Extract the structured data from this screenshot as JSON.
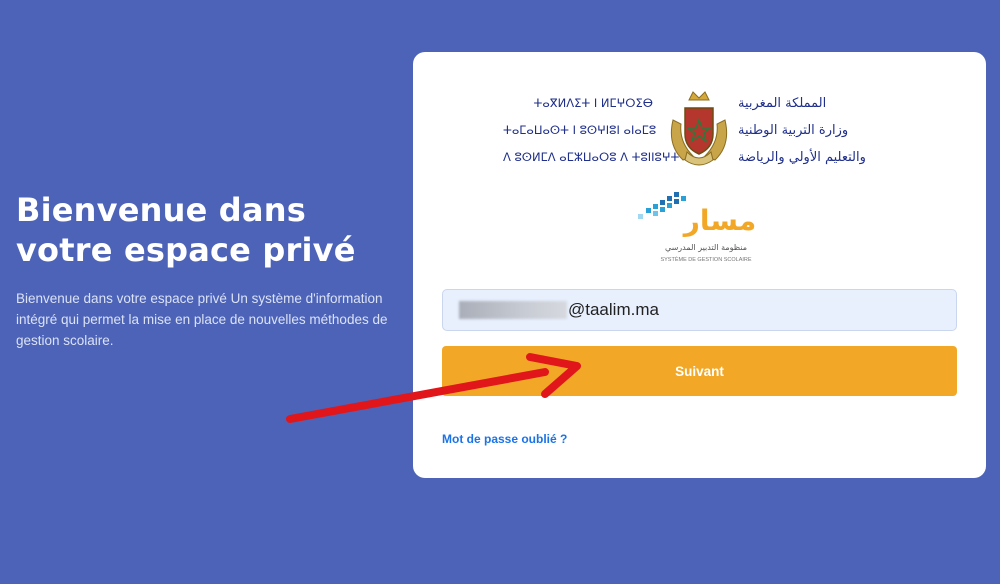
{
  "welcome": {
    "title": "Bienvenue dans votre espace privé",
    "description": "Bienvenue dans votre espace privé Un système d'information intégré qui permet la mise en place de nouvelles méthodes de gestion scolaire."
  },
  "header": {
    "tifinagh_lines": [
      "ⵜⴰⴳⵍⴷⵉⵜ ⵏ ⵍⵎⵖⵔⵉⴱ",
      "ⵜⴰⵎⴰⵡⴰⵙⵜ ⵏ ⵓⵙⵖⵏⵓⵏ ⴰⵏⴰⵎⵓ",
      "ⴷ ⵓⵙⵍⵎⴷ ⴰⵎⵣⵡⴰⵔⵓ ⴷ ⵜⵓⵏⵏⵓⵖⵜ"
    ],
    "arabic_lines": [
      "المملكة المغربية",
      "وزارة التربية الوطنية",
      "والتعليم الأولي والرياضة"
    ]
  },
  "logo": {
    "name": "مسار",
    "subtitle_ar": "منظومة التدبير المدرسي",
    "subtitle_fr": "SYSTÈME DE GESTION SCOLAIRE"
  },
  "form": {
    "email_domain": "@taalim.ma",
    "submit_label": "Suivant",
    "forgot_label": "Mot de passe oublié ?"
  },
  "colors": {
    "background": "#4c63b8",
    "button": "#f2a826",
    "link": "#1a73e8",
    "annotation_arrow": "#e0161b"
  }
}
